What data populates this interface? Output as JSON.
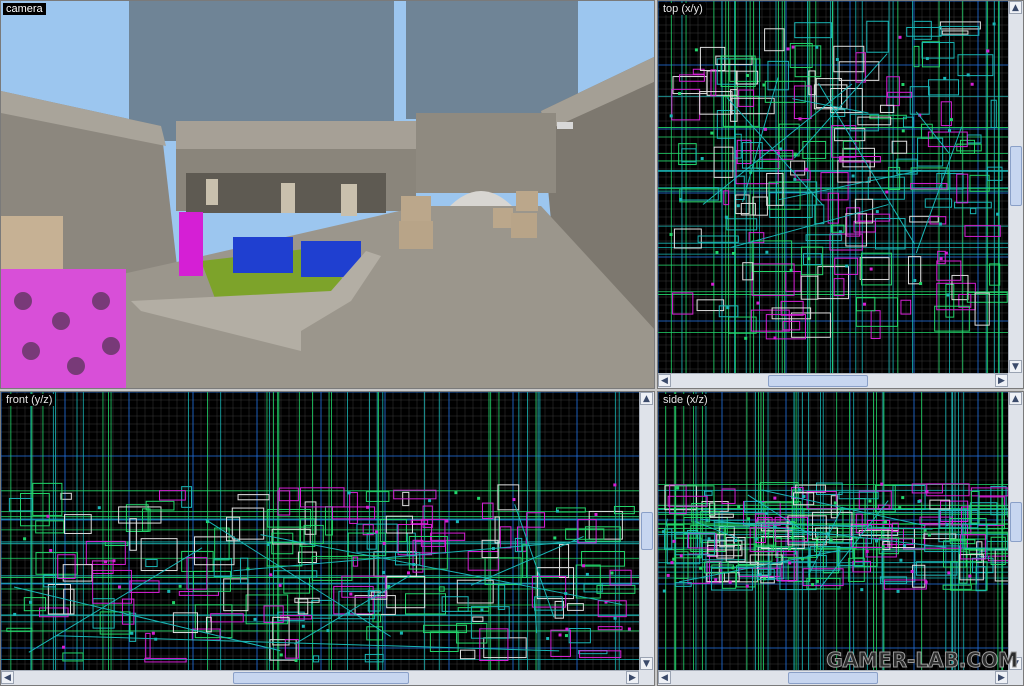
{
  "viewports": {
    "camera": {
      "label": "camera"
    },
    "top": {
      "label": "top (x/y)"
    },
    "front": {
      "label": "front (y/z)"
    },
    "side": {
      "label": "side (x/z)"
    }
  },
  "scrollbars": {
    "left_arrow": "◀",
    "right_arrow": "▶",
    "up_arrow": "▲",
    "down_arrow": "▼",
    "thumb_grip": "≡"
  },
  "watermark": {
    "text": "GAMER-LAB.COM"
  },
  "colors": {
    "grid_major": "#1e6fe0",
    "grid_minor": "#3a3a3a",
    "brush_teal": "#19b6b6",
    "brush_green": "#22d66a",
    "brush_magenta": "#d51fd5",
    "brush_white": "#e0e0e0",
    "sky": "#9cc6ef",
    "stone": "#8f8a80"
  }
}
